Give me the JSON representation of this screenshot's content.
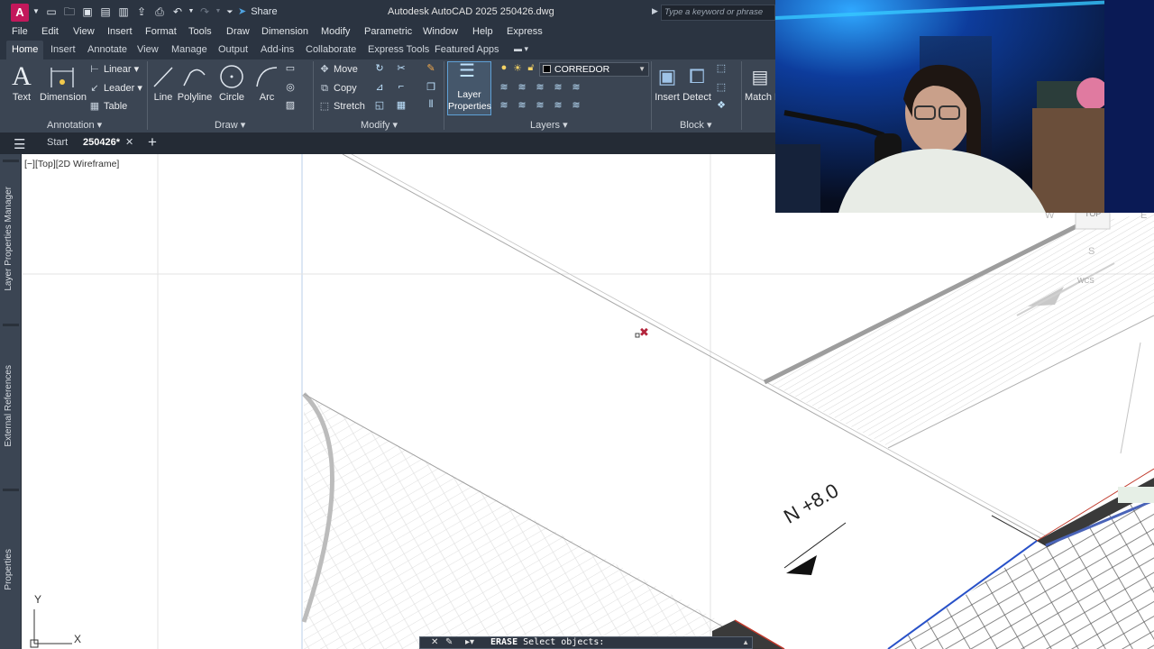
{
  "app": {
    "title": "Autodesk AutoCAD 2025   250426.dwg",
    "logo_letter": "A",
    "share_label": "Share",
    "search_placeholder": "Type a keyword or phrase"
  },
  "menu": [
    "File",
    "Edit",
    "View",
    "Insert",
    "Format",
    "Tools",
    "Draw",
    "Dimension",
    "Modify",
    "Parametric",
    "Window",
    "Help",
    "Express"
  ],
  "ribbon_tabs": [
    "Home",
    "Insert",
    "Annotate",
    "View",
    "Manage",
    "Output",
    "Add-ins",
    "Collaborate",
    "Express Tools",
    "Featured Apps"
  ],
  "ribbon": {
    "annotation": {
      "title": "Annotation",
      "text": "Text",
      "dimension": "Dimension",
      "linear": "Linear",
      "leader": "Leader",
      "table": "Table"
    },
    "draw": {
      "title": "Draw",
      "line": "Line",
      "polyline": "Polyline",
      "circle": "Circle",
      "arc": "Arc"
    },
    "modify": {
      "title": "Modify",
      "move": "Move",
      "copy": "Copy",
      "stretch": "Stretch"
    },
    "layers": {
      "title": "Layers",
      "layer_properties": "Layer Properties",
      "current_layer": "CORREDOR"
    },
    "block": {
      "title": "Block",
      "insert": "Insert",
      "detect": "Detect",
      "match_properties": "Match Propert"
    }
  },
  "file_tabs": {
    "start": "Start",
    "active": "250426*"
  },
  "side_palettes": [
    "Layer Properties Manager",
    "External References",
    "Properties"
  ],
  "viewport_label": "[−][Top][2D Wireframe]",
  "drawing": {
    "annotation_text": "N +8.0"
  },
  "viewcube": {
    "face": "TOP",
    "south": "S",
    "west": "W",
    "east": "E",
    "wcs": "WCS"
  },
  "ucs": {
    "x": "X",
    "y": "Y"
  },
  "command_line": {
    "command": "ERASE",
    "prompt": "Select objects:"
  },
  "colors": {
    "title_bg": "#2b3441",
    "ribbon_bg": "#3b4553",
    "accent": "#5fa0d6",
    "webcam_glow": "#1e6cff"
  }
}
